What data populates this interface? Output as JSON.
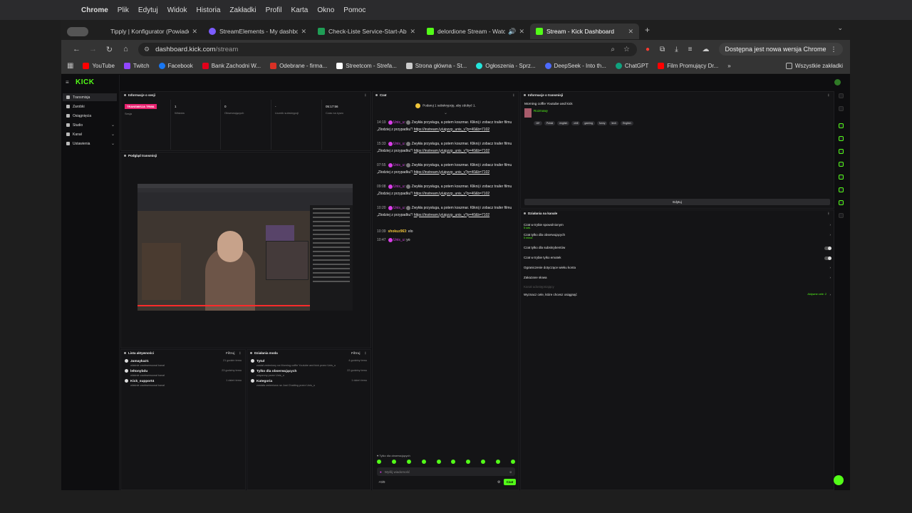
{
  "macbar": {
    "app": "Chrome",
    "menus": [
      "Plik",
      "Edytuj",
      "Widok",
      "Historia",
      "Zakładki",
      "Profil",
      "Karta",
      "Okno",
      "Pomoc"
    ]
  },
  "tabs": [
    {
      "title": "Tipply | Konfigurator (Powiadomienia)",
      "color": "#ffffff"
    },
    {
      "title": "StreamElements - My dashboard",
      "color": "#7b5cff"
    },
    {
      "title": "Check-Liste Service-Start-Abrechnung",
      "color": "#1f9d55"
    },
    {
      "title": "delordione Stream - Watch",
      "color": "#53fc18"
    },
    {
      "title": "Stream - Kick Dashboard",
      "color": "#53fc18"
    }
  ],
  "omnibox": {
    "url_host": "dashboard.kick.com",
    "url_path": "/stream",
    "update_label": "Dostępna jest nowa wersja Chrome"
  },
  "bookmarks": [
    {
      "label": "YouTube",
      "color": "#ff0000"
    },
    {
      "label": "Twitch",
      "color": "#9146ff"
    },
    {
      "label": "Facebook",
      "color": "#1877f2"
    },
    {
      "label": "Bank Zachodni W...",
      "color": "#e2001a"
    },
    {
      "label": "Odebrane - firma...",
      "color": "#d93025"
    },
    {
      "label": "Streetcom - Strefa...",
      "color": "#ffffff"
    },
    {
      "label": "Strona główna - St...",
      "color": "#cccccc"
    },
    {
      "label": "Ogłoszenia - Sprz...",
      "color": "#23e5db"
    },
    {
      "label": "DeepSeek - Into th...",
      "color": "#4d6bfe"
    },
    {
      "label": "ChatGPT",
      "color": "#10a37f"
    },
    {
      "label": "Film Promujący Dr...",
      "color": "#ff0000"
    }
  ],
  "bookmarks_all": "Wszystkie zakładki",
  "nav": {
    "logo": "KICK",
    "items": [
      {
        "label": "Transmisja",
        "chev": ""
      },
      {
        "label": "Zarobki",
        "chev": ""
      },
      {
        "label": "Osiągnięcia",
        "chev": ""
      },
      {
        "label": "Studio",
        "chev": "⌄"
      },
      {
        "label": "Kanał",
        "chev": "⌄"
      },
      {
        "label": "Ustawienia",
        "chev": "⌄"
      }
    ]
  },
  "session": {
    "title": "Informacje o sesji",
    "badge": "TRANSMISJA TRWA",
    "stats": [
      {
        "value": "",
        "label": "Sesja"
      },
      {
        "value": "1",
        "label": "Widzów"
      },
      {
        "value": "0",
        "label": "Obserwujących"
      },
      {
        "value": "-",
        "label": "Licznik subskrypcji"
      },
      {
        "value": "05:17:56",
        "label": "Czas na żywo"
      }
    ]
  },
  "preview": {
    "title": "Podgląd transmisji"
  },
  "activity": {
    "title": "Lista aktywności",
    "filter": "Filtruj",
    "items": [
      {
        "name": "Jamayka21",
        "desc": "właśnie zaobserwował kanał",
        "time": "21 godzin temu"
      },
      {
        "name": "leltonybdu",
        "desc": "właśnie zaobserwował kanał",
        "time": "23 godziny temu"
      },
      {
        "name": "Kick_support4",
        "desc": "właśnie zaobserwował kanał",
        "time": "1 dzień temu"
      }
    ]
  },
  "modactions": {
    "title": "Działania moda",
    "filter": "Filtruj",
    "items": [
      {
        "name": "Tytuł",
        "desc": "został zmieniony na Morning coffie Youtube and kick przez Unis_u",
        "time": "4 godziny temu"
      },
      {
        "name": "Tylko dla obserwujących",
        "desc": "włączony przez Unis_u",
        "time": "22 godziny temu"
      },
      {
        "name": "Kategoria",
        "desc": "została zmieniona na Just Chatting przez Unis_u",
        "time": "1 dzień temu"
      }
    ]
  },
  "chat": {
    "title": "Czat",
    "sub_banner": "Podaruj 1 subskrypcję, aby zdobyć 1.",
    "messages": [
      {
        "ts": "14:19",
        "user": "Unis_u",
        "text": "Zwykła przysługa, a potem koszmar. Kliknij i zobacz trailer filmu „Złodziej z przypadku”!",
        "link": "https://instream.ly/uipzzp_unis_v?p=40&b=7102"
      },
      {
        "ts": "15:33",
        "user": "Unis_u",
        "text": "Zwykła przysługa, a potem koszmar. Kliknij i zobacz trailer filmu „Złodziej z przypadku”!",
        "link": "https://instream.ly/uipzzp_unis_v?p=40&b=7102"
      },
      {
        "ts": "07:55",
        "user": "Unis_u",
        "text": "Zwykła przysługa, a potem koszmar. Kliknij i zobacz trailer filmu „Złodziej z przypadku”!",
        "link": "https://instream.ly/uipzzp_unis_v?p=40&b=7102"
      },
      {
        "ts": "09:08",
        "user": "Unis_u",
        "text": "Zwykła przysługa, a potem koszmar. Kliknij i zobacz trailer filmu „Złodziej z przypadku”!",
        "link": "https://instream.ly/uipzzp_unis_v?p=40&b=7102"
      },
      {
        "ts": "10:20",
        "user": "Unis_u",
        "text": "Zwykła przysługa, a potem koszmar. Kliknij i zobacz trailer filmu „Złodziej z przypadku”!",
        "link": "https://instream.ly/uipzzp_unis_v?p=40&b=7102"
      }
    ],
    "short": [
      {
        "ts": "10:39",
        "user": "shokuz963",
        "text": "elo"
      },
      {
        "ts": "10:47",
        "user": "Unis_u",
        "text": "yo"
      }
    ],
    "followers_only": "Tylko dla obserwujących",
    "input_placeholder": "Wyślij wiadomość",
    "count": "0/0",
    "send": "Czat"
  },
  "streaminfo": {
    "title": "Informacje o transmisji",
    "stream_title": "Morning coffie Youtube and kick",
    "category": "Rozmowy",
    "tags": [
      "18+",
      "Polski",
      "english",
      "chill",
      "gaming",
      "funny",
      "tech",
      "English"
    ],
    "edit": "Edytuj"
  },
  "channel": {
    "title": "Działania na kanale",
    "items": [
      {
        "label": "Czat w trybie spowolnionym",
        "sub": "5 sek.",
        "control": "chevron"
      },
      {
        "label": "Czat tylko dla obserwujących",
        "sub": "0 minut",
        "control": "chevron"
      },
      {
        "label": "Czat tylko dla subskrybentów",
        "sub": "",
        "control": "toggle"
      },
      {
        "label": "Czat w trybie tylko emotek",
        "sub": "",
        "control": "toggle"
      },
      {
        "label": "Ograniczenie dotyczące wieku konta",
        "sub": "",
        "control": "chevron"
      },
      {
        "label": "Zakazane słowa",
        "sub": "",
        "control": "chevron"
      },
      {
        "label": "Kanał udostępniający",
        "sub": "",
        "control": "none"
      },
      {
        "label": "Wyznacz cele, które chcesz osiągnąć",
        "sub": "",
        "control": "chevron"
      }
    ],
    "goal_status": "Aktywne cele: 2"
  }
}
